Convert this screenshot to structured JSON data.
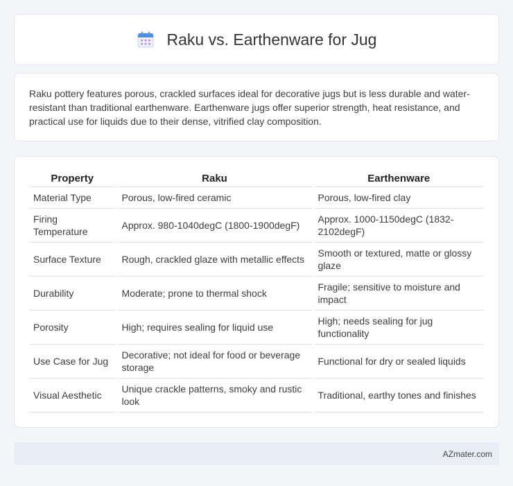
{
  "header": {
    "title": "Raku vs. Earthenware for Jug",
    "icon": "calendar-icon"
  },
  "summary": {
    "text": "Raku pottery features porous, crackled surfaces ideal for decorative jugs but is less durable and water-resistant than traditional earthenware. Earthenware jugs offer superior strength, heat resistance, and practical use for liquids due to their dense, vitrified clay composition."
  },
  "table": {
    "headers": [
      "Property",
      "Raku",
      "Earthenware"
    ],
    "rows": [
      [
        "Material Type",
        "Porous, low-fired ceramic",
        "Porous, low-fired clay"
      ],
      [
        "Firing Temperature",
        "Approx. 980-1040degC (1800-1900degF)",
        "Approx. 1000-1150degC (1832-2102degF)"
      ],
      [
        "Surface Texture",
        "Rough, crackled glaze with metallic effects",
        "Smooth or textured, matte or glossy glaze"
      ],
      [
        "Durability",
        "Moderate; prone to thermal shock",
        "Fragile; sensitive to moisture and impact"
      ],
      [
        "Porosity",
        "High; requires sealing for liquid use",
        "High; needs sealing for jug functionality"
      ],
      [
        "Use Case for Jug",
        "Decorative; not ideal for food or beverage storage",
        "Functional for dry or sealed liquids"
      ],
      [
        "Visual Aesthetic",
        "Unique crackle patterns, smoky and rustic look",
        "Traditional, earthy tones and finishes"
      ]
    ]
  },
  "footer": {
    "brand": "AZmater.com"
  },
  "colors": {
    "background": "#f3f5f8",
    "card": "#ffffff",
    "footer": "#e9edf5",
    "icon_accent": "#4a8fe8"
  }
}
